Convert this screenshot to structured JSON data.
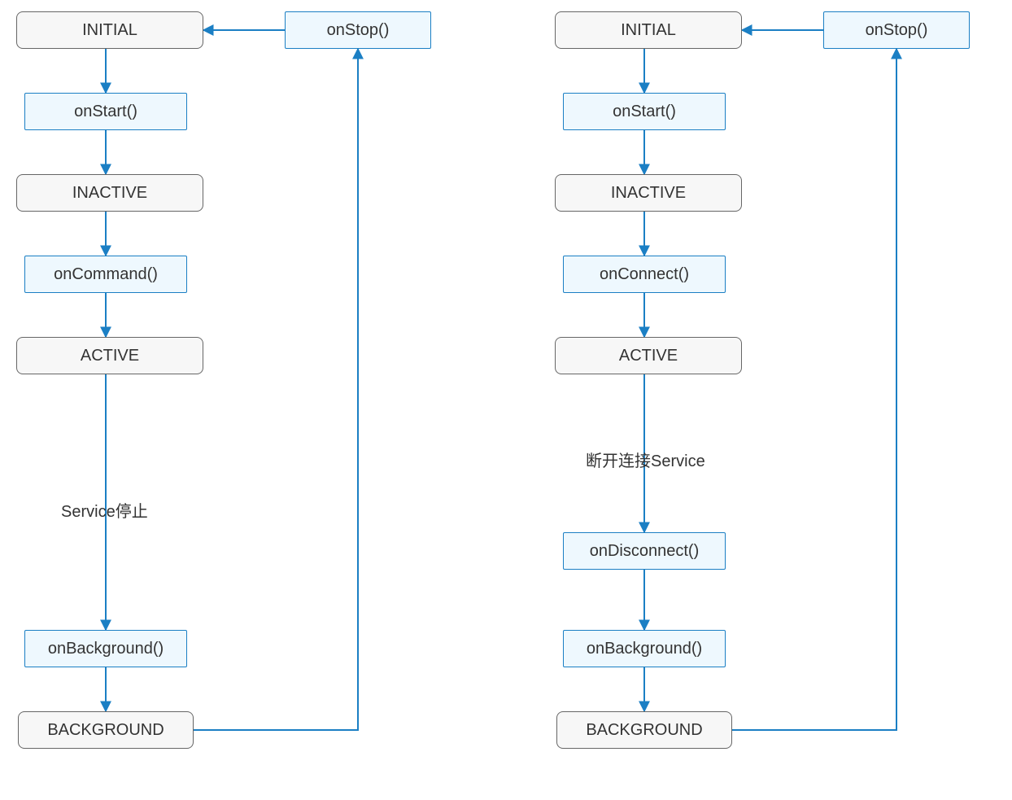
{
  "colors": {
    "state_fill": "#f7f7f7",
    "state_border": "#666666",
    "callback_fill": "#eef8fe",
    "callback_border": "#1b7fc4",
    "arrow": "#1b7fc4"
  },
  "left": {
    "initial": "INITIAL",
    "onStop": "onStop()",
    "onStart": "onStart()",
    "inactive": "INACTIVE",
    "onCommand": "onCommand()",
    "active": "ACTIVE",
    "edgeActiveToBackground": "Service停止",
    "onBackground": "onBackground()",
    "background": "BACKGROUND"
  },
  "right": {
    "initial": "INITIAL",
    "onStop": "onStop()",
    "onStart": "onStart()",
    "inactive": "INACTIVE",
    "onConnect": "onConnect()",
    "active": "ACTIVE",
    "edgeActiveToDisconnect": "断开连接Service",
    "onDisconnect": "onDisconnect()",
    "onBackground": "onBackground()",
    "background": "BACKGROUND"
  }
}
